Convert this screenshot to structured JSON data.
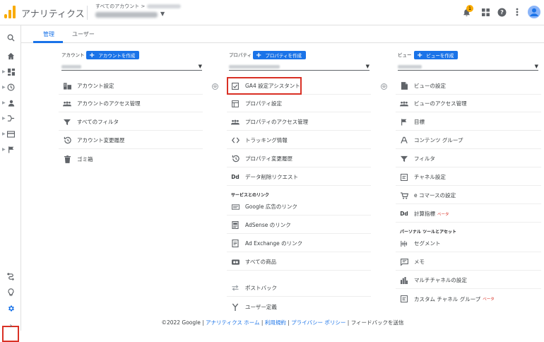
{
  "header": {
    "app_title": "アナリティクス",
    "breadcrumb": "すべてのアカウント >",
    "notification_count": "1"
  },
  "tabs": [
    {
      "label": "管理"
    },
    {
      "label": "ユーザー"
    }
  ],
  "columns": {
    "account": {
      "heading": "アカウント",
      "create_label": "アカウントを作成",
      "items": [
        {
          "label": "アカウント設定",
          "icon": "building-icon"
        },
        {
          "label": "アカウントのアクセス管理",
          "icon": "people-icon"
        },
        {
          "label": "すべてのフィルタ",
          "icon": "filter-icon"
        },
        {
          "label": "アカウント変更履歴",
          "icon": "history-icon"
        },
        {
          "label": "ゴミ箱",
          "icon": "trash-icon"
        }
      ]
    },
    "property": {
      "heading": "プロパティ",
      "create_label": "プロパティを作成",
      "items": [
        {
          "label": "GA4 設定アシスタント",
          "icon": "checkbox-icon"
        },
        {
          "label": "プロパティ設定",
          "icon": "settings-panel-icon"
        },
        {
          "label": "プロパティのアクセス管理",
          "icon": "people-icon"
        },
        {
          "label": "トラッキング情報",
          "icon": "code-icon"
        },
        {
          "label": "プロパティ変更履歴",
          "icon": "history-icon"
        },
        {
          "label": "データ削除リクエスト",
          "icon": "dd-icon"
        }
      ],
      "section_title": "サービスとのリンク",
      "links": [
        {
          "label": "Google 広告のリンク",
          "icon": "ads-icon"
        },
        {
          "label": "AdSense のリンク",
          "icon": "adsense-icon"
        },
        {
          "label": "Ad Exchange のリンク",
          "icon": "adexchange-icon"
        },
        {
          "label": "すべての商品",
          "icon": "products-icon"
        }
      ],
      "more": [
        {
          "label": "ポストバック",
          "icon": "postback-icon"
        },
        {
          "label": "ユーザー定義",
          "icon": "fork-icon"
        }
      ]
    },
    "view": {
      "heading": "ビュー",
      "create_label": "ビューを作成",
      "items": [
        {
          "label": "ビューの設定",
          "icon": "document-icon"
        },
        {
          "label": "ビューのアクセス管理",
          "icon": "people-icon"
        },
        {
          "label": "目標",
          "icon": "flag-icon"
        },
        {
          "label": "コンテンツ グループ",
          "icon": "content-group-icon"
        },
        {
          "label": "フィルタ",
          "icon": "filter-icon"
        },
        {
          "label": "チャネル設定",
          "icon": "channel-icon"
        },
        {
          "label": "e コマースの設定",
          "icon": "cart-icon"
        },
        {
          "label": "計算指標",
          "beta": "ベータ",
          "icon": "dd-icon"
        }
      ],
      "section_title": "パーソナル ツールとアセット",
      "tools": [
        {
          "label": "セグメント",
          "icon": "segment-icon"
        },
        {
          "label": "メモ",
          "icon": "memo-icon"
        },
        {
          "label": "マルチチャネルの設定",
          "icon": "bar-chart-icon"
        },
        {
          "label": "カスタム チャネル グループ",
          "beta": "ベータ",
          "icon": "custom-channel-icon"
        }
      ]
    }
  },
  "footer": {
    "copyright": "©2022 Google |",
    "home": "アナリティクス ホーム",
    "terms": "利用規約",
    "privacy": "プライバシー ポリシー",
    "feedback": "フィードバックを送信",
    "sep": "|"
  },
  "colors": {
    "accent": "#1a73e8",
    "highlight": "#d93025",
    "logo": "#f9ab00",
    "badge": "#f9ab00"
  }
}
